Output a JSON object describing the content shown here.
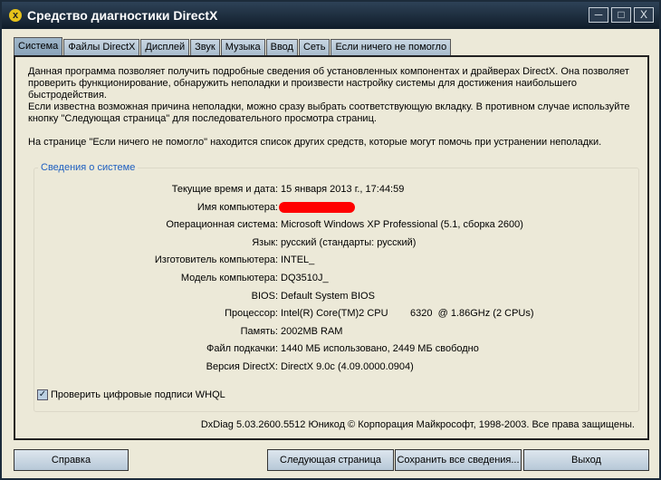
{
  "window": {
    "title": "Средство диагностики DirectX",
    "minimize": "─",
    "maximize": "□",
    "close": "X"
  },
  "tabs": [
    "Система",
    "Файлы DirectX",
    "Дисплей",
    "Звук",
    "Музыка",
    "Ввод",
    "Сеть",
    "Если ничего не помогло"
  ],
  "intro": [
    "Данная программа позволяет получить подробные сведения об установленных компонентах и драйверах DirectX. Она позволяет проверить функционирование, обнаружить неполадки и произвести настройку системы для достижения наибольшего быстродействия.",
    "Если известна возможная причина неполадки, можно сразу выбрать соответствующую вкладку. В противном случае используйте кнопку \"Следующая страница\" для последовательного просмотра страниц.",
    "На странице \"Если ничего не помогло\" находится список других средств, которые могут помочь при устранении неполадки."
  ],
  "system_info": {
    "title": "Сведения о системе",
    "rows": [
      {
        "label": "Текущие время и дата:",
        "value": "15 января 2013 г., 17:44:59"
      },
      {
        "label": "Имя компьютера:",
        "value": null
      },
      {
        "label": "Операционная система:",
        "value": "Microsoft Windows XP Professional (5.1, сборка 2600)"
      },
      {
        "label": "Язык:",
        "value": "русский (стандарты: русский)"
      },
      {
        "label": "Изготовитель компьютера:",
        "value": "INTEL_"
      },
      {
        "label": "Модель компьютера:",
        "value": "DQ3510J_"
      },
      {
        "label": "BIOS:",
        "value": "Default System BIOS"
      },
      {
        "label": "Процессор:",
        "value": "Intel(R) Core(TM)2 CPU        6320  @ 1.86GHz (2 CPUs)"
      },
      {
        "label": "Память:",
        "value": "2002MB RAM"
      },
      {
        "label": "Файл подкачки:",
        "value": "1440 МБ использовано, 2449 МБ свободно"
      },
      {
        "label": "Версия DirectX:",
        "value": "DirectX 9.0c (4.09.0000.0904)"
      }
    ]
  },
  "whql": {
    "label": "Проверить цифровые подписи WHQL",
    "checked": true,
    "mark": "✓"
  },
  "footer": "DxDiag 5.03.2600.5512 Юникод  © Корпорация Майкрософт, 1998-2003.  Все права защищены.",
  "buttons": {
    "help": "Справка",
    "next": "Следующая страница",
    "save": "Сохранить все сведения...",
    "exit": "Выход"
  }
}
